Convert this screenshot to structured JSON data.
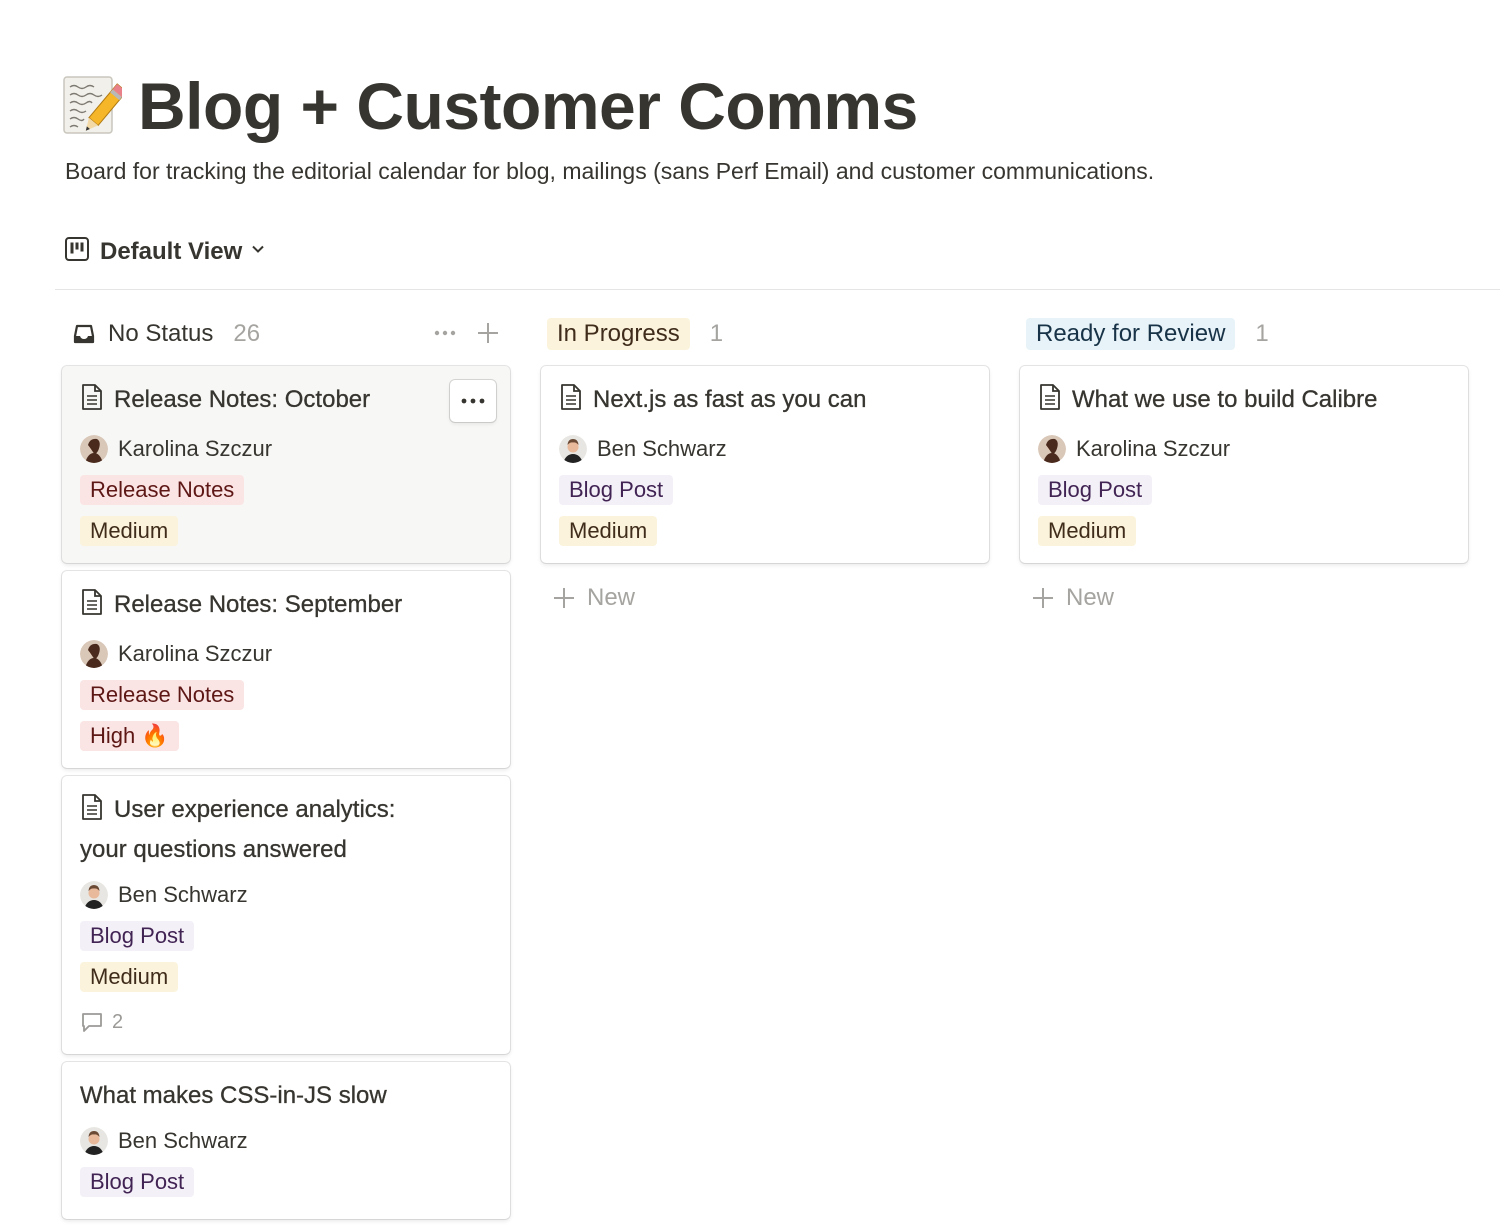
{
  "page": {
    "icon": "memo-icon",
    "title": "Blog + Customer Comms",
    "description": "Board for tracking the editorial calendar for blog, mailings (sans Perf Email) and customer communications."
  },
  "view": {
    "label": "Default View",
    "icon": "board-view-icon"
  },
  "columns": [
    {
      "title": "No Status",
      "count": "26",
      "cards": [
        {
          "title": "Release Notes: October",
          "person": "Karolina Szczur",
          "tags": [
            "Release Notes",
            "Medium"
          ]
        },
        {
          "title": "Release Notes: September",
          "person": "Karolina Szczur",
          "tags": [
            "Release Notes",
            "High 🔥"
          ]
        },
        {
          "title": "User experience analytics: your questions answered",
          "person": "Ben Schwarz",
          "tags": [
            "Blog Post",
            "Medium"
          ],
          "comments": "2"
        },
        {
          "title": "What makes CSS-in-JS slow",
          "person": "Ben Schwarz",
          "tags": [
            "Blog Post"
          ]
        }
      ]
    },
    {
      "title": "In Progress",
      "count": "1",
      "cards": [
        {
          "title": "Next.js as fast as you can",
          "person": "Ben Schwarz",
          "tags": [
            "Blog Post",
            "Medium"
          ]
        }
      ],
      "new_label": "New"
    },
    {
      "title": "Ready for Review",
      "count": "1",
      "cards": [
        {
          "title": "What we use to build Calibre",
          "person": "Karolina Szczur",
          "tags": [
            "Blog Post",
            "Medium"
          ]
        }
      ],
      "new_label": "New"
    }
  ],
  "colors": {
    "in_progress_bg": "#fbf3db",
    "in_progress_text": "#402c1b",
    "review_bg": "#e7f3f8",
    "review_text": "#183347",
    "release_notes_bg": "#fbe4e4",
    "release_notes_text": "#5d1715",
    "blog_post_bg": "#f4f0f7",
    "blog_post_text": "#412454",
    "medium_bg": "#fbf3db",
    "medium_text": "#402c1b",
    "high_bg": "#fbe4e4",
    "high_text": "#5d1715"
  }
}
